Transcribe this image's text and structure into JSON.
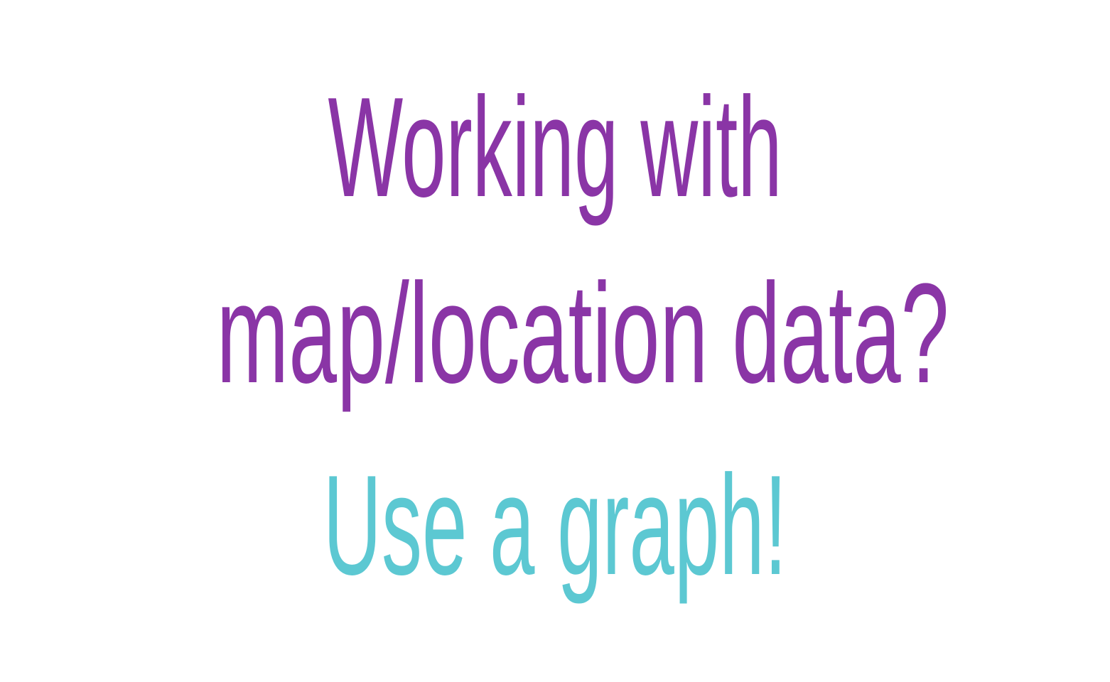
{
  "slide": {
    "lines": [
      {
        "text": "Working with",
        "color": "#8a35a6"
      },
      {
        "text": "map/location data?",
        "color": "#8a35a6"
      },
      {
        "text": "Use a graph!",
        "color": "#5cc8d2"
      }
    ]
  }
}
